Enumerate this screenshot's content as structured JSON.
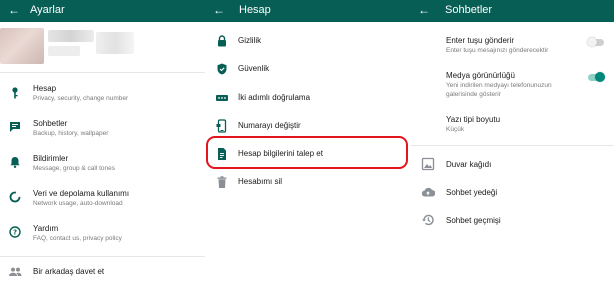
{
  "colors": {
    "header_bg": "#075e54",
    "accent": "#00897b",
    "icon": "#075e54",
    "highlight": "#e3141c"
  },
  "settings": {
    "title": "Ayarlar",
    "items": [
      {
        "label": "Hesap",
        "sub": "Privacy, security, change number",
        "icon": "key-icon"
      },
      {
        "label": "Sohbetler",
        "sub": "Backup, history, wallpaper",
        "icon": "chat-icon"
      },
      {
        "label": "Bildirimler",
        "sub": "Message, group & call tones",
        "icon": "bell-icon"
      },
      {
        "label": "Veri ve depolama kullanımı",
        "sub": "Network usage, auto-download",
        "icon": "data-usage-icon"
      },
      {
        "label": "Yardım",
        "sub": "FAQ, contact us, privacy policy",
        "icon": "help-icon"
      }
    ],
    "invite_label": "Bir arkadaş davet et"
  },
  "account": {
    "title": "Hesap",
    "items": [
      {
        "label": "Gizlilik",
        "icon": "lock-icon"
      },
      {
        "label": "Güvenlik",
        "icon": "shield-icon"
      },
      {
        "label": "İki adımlı doğrulama",
        "icon": "dots-icon"
      },
      {
        "label": "Numarayı değiştir",
        "icon": "phone-swap-icon"
      },
      {
        "label": "Hesap bilgilerini talep et",
        "icon": "document-icon"
      },
      {
        "label": "Hesabımı sil",
        "icon": "trash-icon"
      }
    ]
  },
  "chats": {
    "title": "Sohbetler",
    "enter_send": {
      "label": "Enter tuşu gönderir",
      "sub": "Enter tuşu mesajınızı gönderecektir",
      "enabled": false
    },
    "media_visibility": {
      "label": "Medya görünürlüğü",
      "sub_line1": "Yeni indirilen medyayı telefonunuzun",
      "sub_line2": "galerisinde gösterir",
      "enabled": true
    },
    "font_size": {
      "label": "Yazı tipi boyutu",
      "value": "Küçük"
    },
    "items": [
      {
        "label": "Duvar kağıdı",
        "icon": "wallpaper-icon"
      },
      {
        "label": "Sohbet yedeği",
        "icon": "cloud-upload-icon"
      },
      {
        "label": "Sohbet geçmişi",
        "icon": "history-icon"
      }
    ]
  },
  "back_glyph": "←"
}
